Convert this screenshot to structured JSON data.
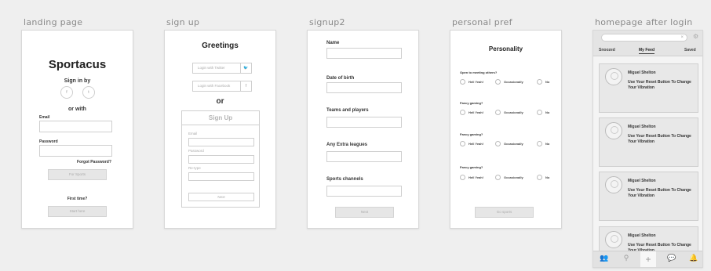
{
  "frames": {
    "landing": "landing page",
    "signup": "sign up",
    "signup2": "signup2",
    "pref": "personal pref",
    "home": "homepage after login"
  },
  "landing": {
    "app_title": "Sportacus",
    "sign_in_by": "Sign in by",
    "twitter_glyph": "t",
    "facebook_glyph": "f",
    "or_with": "or with",
    "email_label": "Email",
    "password_label": "Password",
    "forgot": "Forgot Password?",
    "for_sports": "For Sports",
    "first_time": "First time?",
    "start_here": "Start here"
  },
  "signup": {
    "greeting": "Greetings",
    "twitter_btn": "Login with Twitter",
    "facebook_btn": "Login with Facebook",
    "twitter_glyph": "🐦",
    "facebook_glyph": "f",
    "or": "or",
    "panel_title": "Sign Up",
    "email_label": "Email",
    "password_label": "Password",
    "retype_label": "Re-type",
    "next": "Next"
  },
  "signup2": {
    "fields": [
      "Name",
      "Date of birth",
      "Teams and players",
      "Any Extra leagues",
      "Sports channels"
    ],
    "next": "Next"
  },
  "pref": {
    "title": "Personality",
    "questions": [
      "Open to meeting others?",
      "Fancy gaming?",
      "Fancy gaming?",
      "Fancy gaming?"
    ],
    "options": [
      "Hell Yeah!",
      "Occasionally",
      "No"
    ],
    "go_sports": "Go sports"
  },
  "home": {
    "tabs": [
      "Snoozed",
      "My Feed",
      "Saved"
    ],
    "active_tab": "My Feed",
    "cards": [
      {
        "name": "Miguel Shelton",
        "message": "Use Your Reset Button To Change Your Vibration"
      },
      {
        "name": "Miguel Shelton",
        "message": "Use Your Reset Button To Change Your Vibration"
      },
      {
        "name": "Miguel Shelton",
        "message": "Use Your Reset Button To Change Your Vibration"
      },
      {
        "name": "Miguel Shelton",
        "message": "Use Your Reset Button To Change Your Vibration"
      }
    ],
    "nav_icons": [
      "people-icon",
      "location-pin-icon",
      "plus-icon",
      "chat-icon",
      "bell-icon"
    ],
    "search_clear_glyph": "×",
    "settings_glyph": "⚙",
    "nav_glyphs": [
      "👥",
      "⚲",
      "+",
      "💬",
      "🔔"
    ]
  }
}
